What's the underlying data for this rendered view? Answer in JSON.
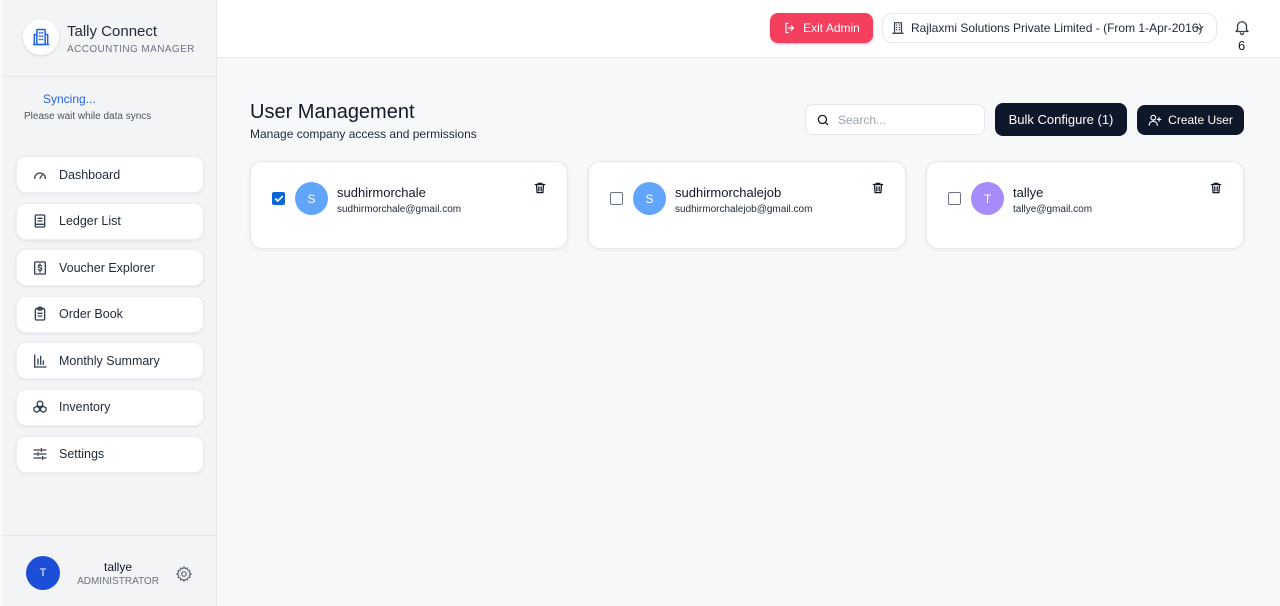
{
  "brand": {
    "title": "Tally Connect",
    "subtitle": "ACCOUNTING MANAGER",
    "logo_icon": "building-icon"
  },
  "sync": {
    "title": "Syncing...",
    "subtitle": "Please wait while data syncs"
  },
  "nav": {
    "items": [
      {
        "label": "Dashboard",
        "icon": "gauge-icon"
      },
      {
        "label": "Ledger List",
        "icon": "book-icon"
      },
      {
        "label": "Voucher Explorer",
        "icon": "dollar-receipt-icon"
      },
      {
        "label": "Order Book",
        "icon": "clipboard-icon"
      },
      {
        "label": "Monthly Summary",
        "icon": "bar-chart-icon"
      },
      {
        "label": "Inventory",
        "icon": "boxes-icon"
      },
      {
        "label": "Settings",
        "icon": "sliders-icon"
      }
    ]
  },
  "footer": {
    "avatar_initial": "T",
    "name": "tallye",
    "role": "ADMINISTRATOR"
  },
  "header": {
    "exit_label": "Exit Admin",
    "company": "Rajlaxmi Solutions Private Limited - (From 1-Apr-2016)",
    "notification_count": "6"
  },
  "main": {
    "title": "User Management",
    "subtitle": "Manage company access and permissions",
    "search_placeholder": "Search...",
    "bulk_label": "Bulk Configure (1)",
    "create_label": "Create User"
  },
  "users": [
    {
      "initial": "S",
      "name": "sudhirmorchale",
      "email": "sudhirmorchale@gmail.com",
      "checked": true,
      "avatar_color": "#60a5fa"
    },
    {
      "initial": "S",
      "name": "sudhirmorchalejob",
      "email": "sudhirmorchalejob@gmail.com",
      "checked": false,
      "avatar_color": "#60a5fa"
    },
    {
      "initial": "T",
      "name": "tallye",
      "email": "tallye@gmail.com",
      "checked": false,
      "avatar_color": "#a78bfa"
    }
  ],
  "colors": {
    "accent": "#0f172a",
    "danger": "#f43f5e",
    "sync": "#2563eb",
    "checkbox": "#0a66d6"
  }
}
